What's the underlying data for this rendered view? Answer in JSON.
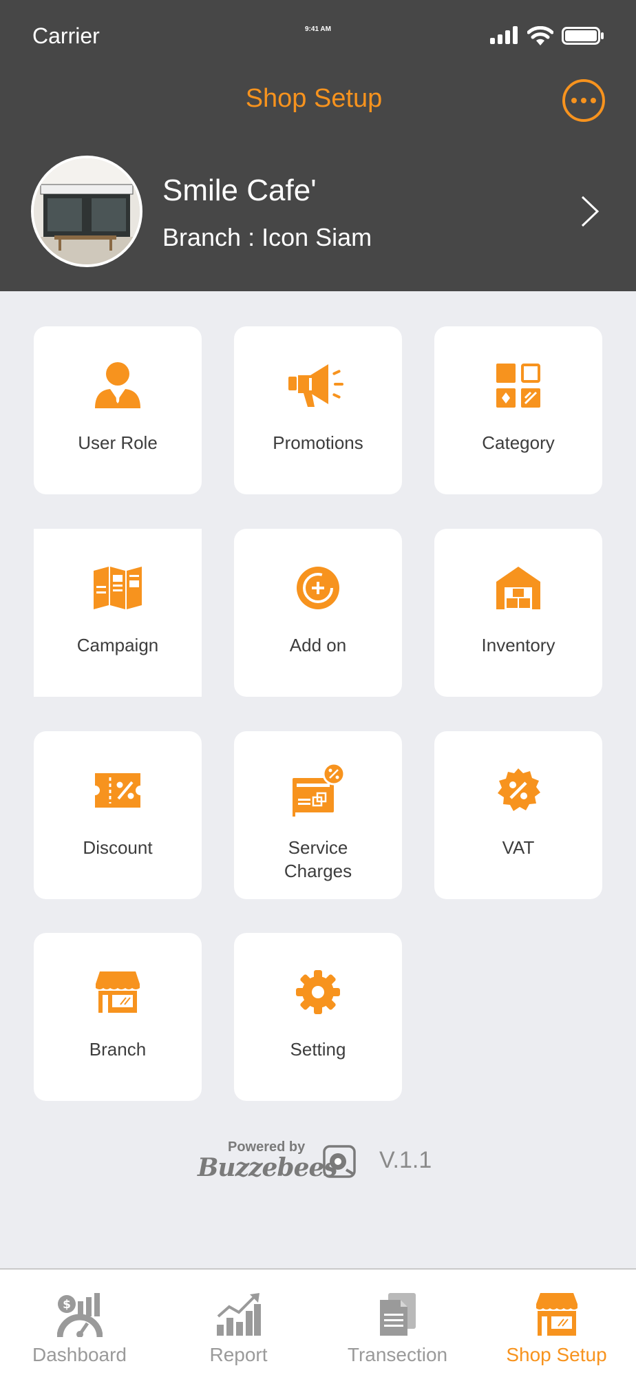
{
  "status_bar": {
    "carrier": "Carrier",
    "time": "9:41 AM"
  },
  "header": {
    "title": "Shop Setup"
  },
  "profile": {
    "shop_name": "Smile Cafe'",
    "branch": "Branch : Icon Siam"
  },
  "menu": [
    {
      "label": "User Role",
      "icon": "user-icon"
    },
    {
      "label": "Promotions",
      "icon": "megaphone-icon"
    },
    {
      "label": "Category",
      "icon": "category-icon"
    },
    {
      "label": "Campaign",
      "icon": "campaign-icon"
    },
    {
      "label": "Add on",
      "icon": "add-on-icon"
    },
    {
      "label": "Inventory",
      "icon": "warehouse-icon"
    },
    {
      "label": "Discount",
      "icon": "discount-ticket-icon"
    },
    {
      "label": "Service\nCharges",
      "icon": "service-charge-icon"
    },
    {
      "label": "VAT",
      "icon": "vat-badge-icon"
    },
    {
      "label": "Branch",
      "icon": "store-icon"
    },
    {
      "label": "Setting",
      "icon": "gear-icon"
    }
  ],
  "footer": {
    "powered_by": "Powered by",
    "brand": "Buzzebees",
    "version": "V.1.1"
  },
  "tabs": [
    {
      "label": "Dashboard",
      "icon": "dashboard-icon"
    },
    {
      "label": "Report",
      "icon": "report-chart-icon"
    },
    {
      "label": "Transection",
      "icon": "document-icon"
    },
    {
      "label": "Shop Setup",
      "icon": "shop-icon"
    }
  ],
  "colors": {
    "accent": "#F7931E",
    "header_bg": "#474747",
    "page_bg": "#ECEDF1",
    "inactive": "#9A9A9A"
  }
}
